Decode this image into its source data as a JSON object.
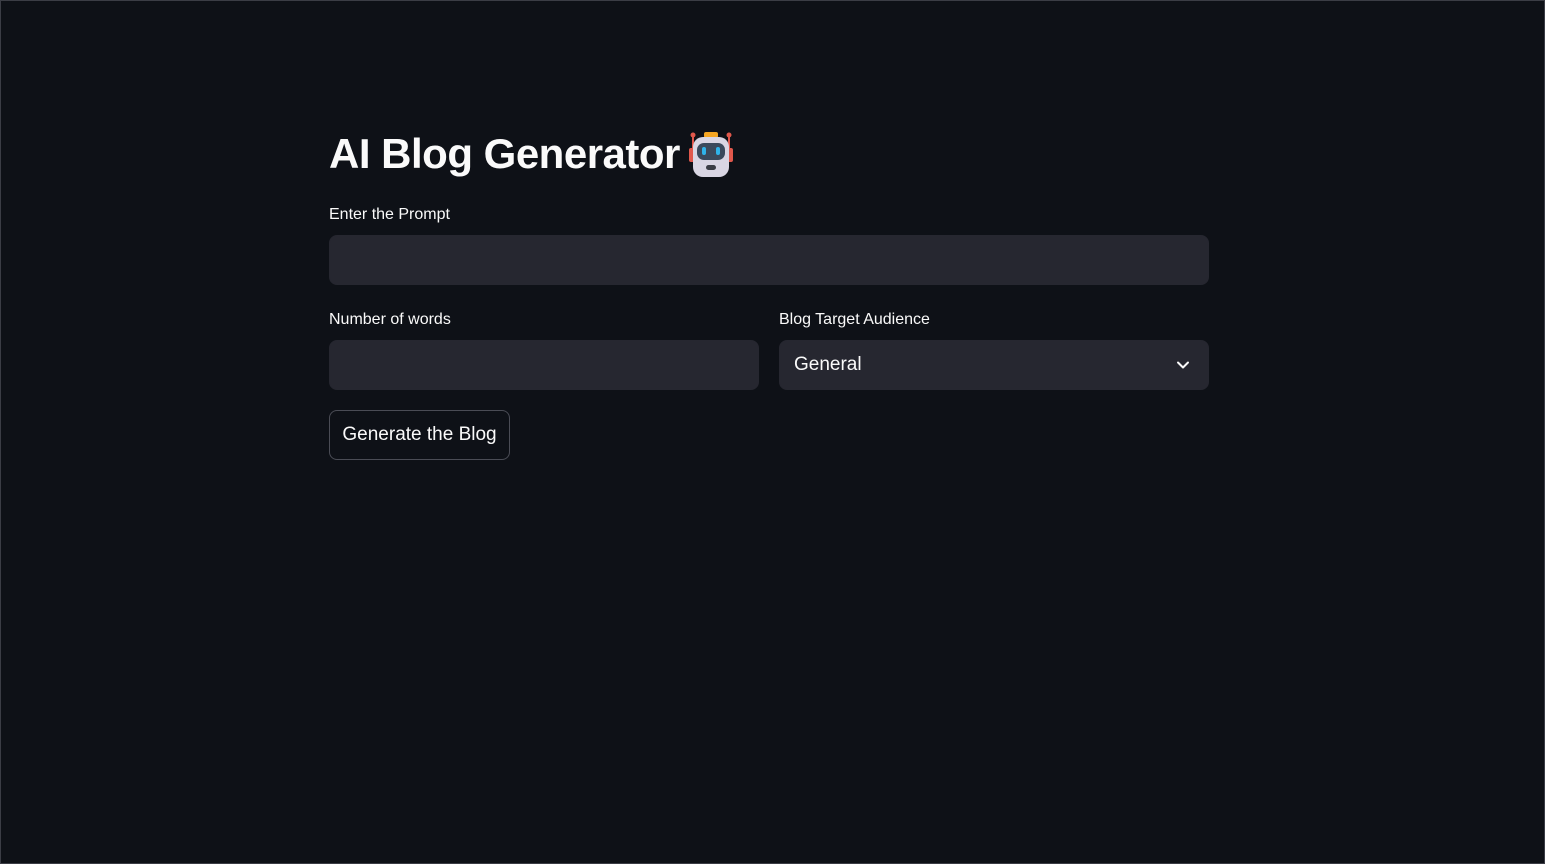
{
  "page": {
    "title": "AI Blog Generator",
    "title_icon": "robot-icon"
  },
  "form": {
    "prompt": {
      "label": "Enter the Prompt",
      "value": "",
      "placeholder": ""
    },
    "word_count": {
      "label": "Number of words",
      "value": "",
      "placeholder": ""
    },
    "audience": {
      "label": "Blog Target Audience",
      "selected": "General",
      "icon": "chevron-down-icon"
    },
    "submit_label": "Generate the Blog"
  },
  "colors": {
    "background": "#0e1117",
    "field_background": "#262730",
    "text": "#fafafa",
    "button_border": "#4a4c55"
  }
}
